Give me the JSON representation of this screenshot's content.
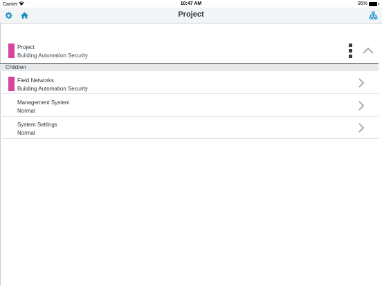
{
  "status_bar": {
    "carrier": "Carrier",
    "time": "10:47 AM",
    "battery": "95%",
    "battery_level": 0.95
  },
  "nav_bar": {
    "title": "Project"
  },
  "header_item": {
    "name": "Project",
    "description": "Building Automation Security",
    "color": "#d6449b"
  },
  "children": {
    "header": "Children",
    "items": [
      {
        "name": "Field Networks",
        "description": "Building Automation Security",
        "has_color": true
      },
      {
        "name": "Management System",
        "description": "Normal",
        "has_color": false
      },
      {
        "name": "System Settings",
        "description": "Normal",
        "has_color": false
      }
    ]
  },
  "colors": {
    "accent": "#1a8fc9",
    "tag": "#d6449b",
    "chevron": "#a9adb1"
  }
}
